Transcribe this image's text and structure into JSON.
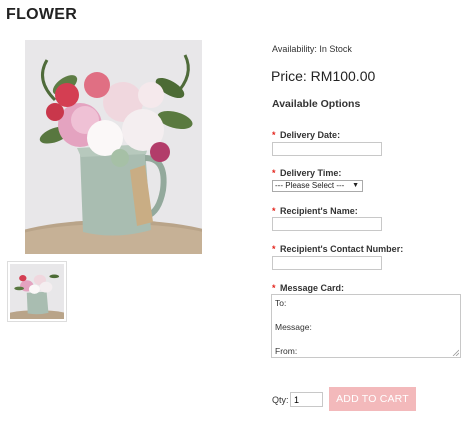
{
  "product": {
    "title": "FLOWER",
    "availability": "Availability: In Stock",
    "price": "Price: RM100.00",
    "options_heading": "Available Options"
  },
  "form": {
    "required_mark": "*",
    "delivery_date_label": "Delivery Date:",
    "delivery_date_value": "",
    "delivery_time_label": "Delivery Time:",
    "delivery_time_selected": "--- Please Select ---",
    "recipient_name_label": "Recipient's Name:",
    "recipient_name_value": "",
    "recipient_contact_label": "Recipient's Contact Number:",
    "recipient_contact_value": "",
    "message_card_label": "Message Card:",
    "message_card_lines": [
      "To:",
      "",
      "Message:",
      "",
      "From:"
    ]
  },
  "cart": {
    "qty_label": "Qty:",
    "qty_value": "1",
    "add_to_cart_label": "ADD TO CART",
    "button_color": "#f3b9bb"
  },
  "colors": {
    "required_mark": "#e3231b",
    "image_background": "#e9e8e9"
  }
}
